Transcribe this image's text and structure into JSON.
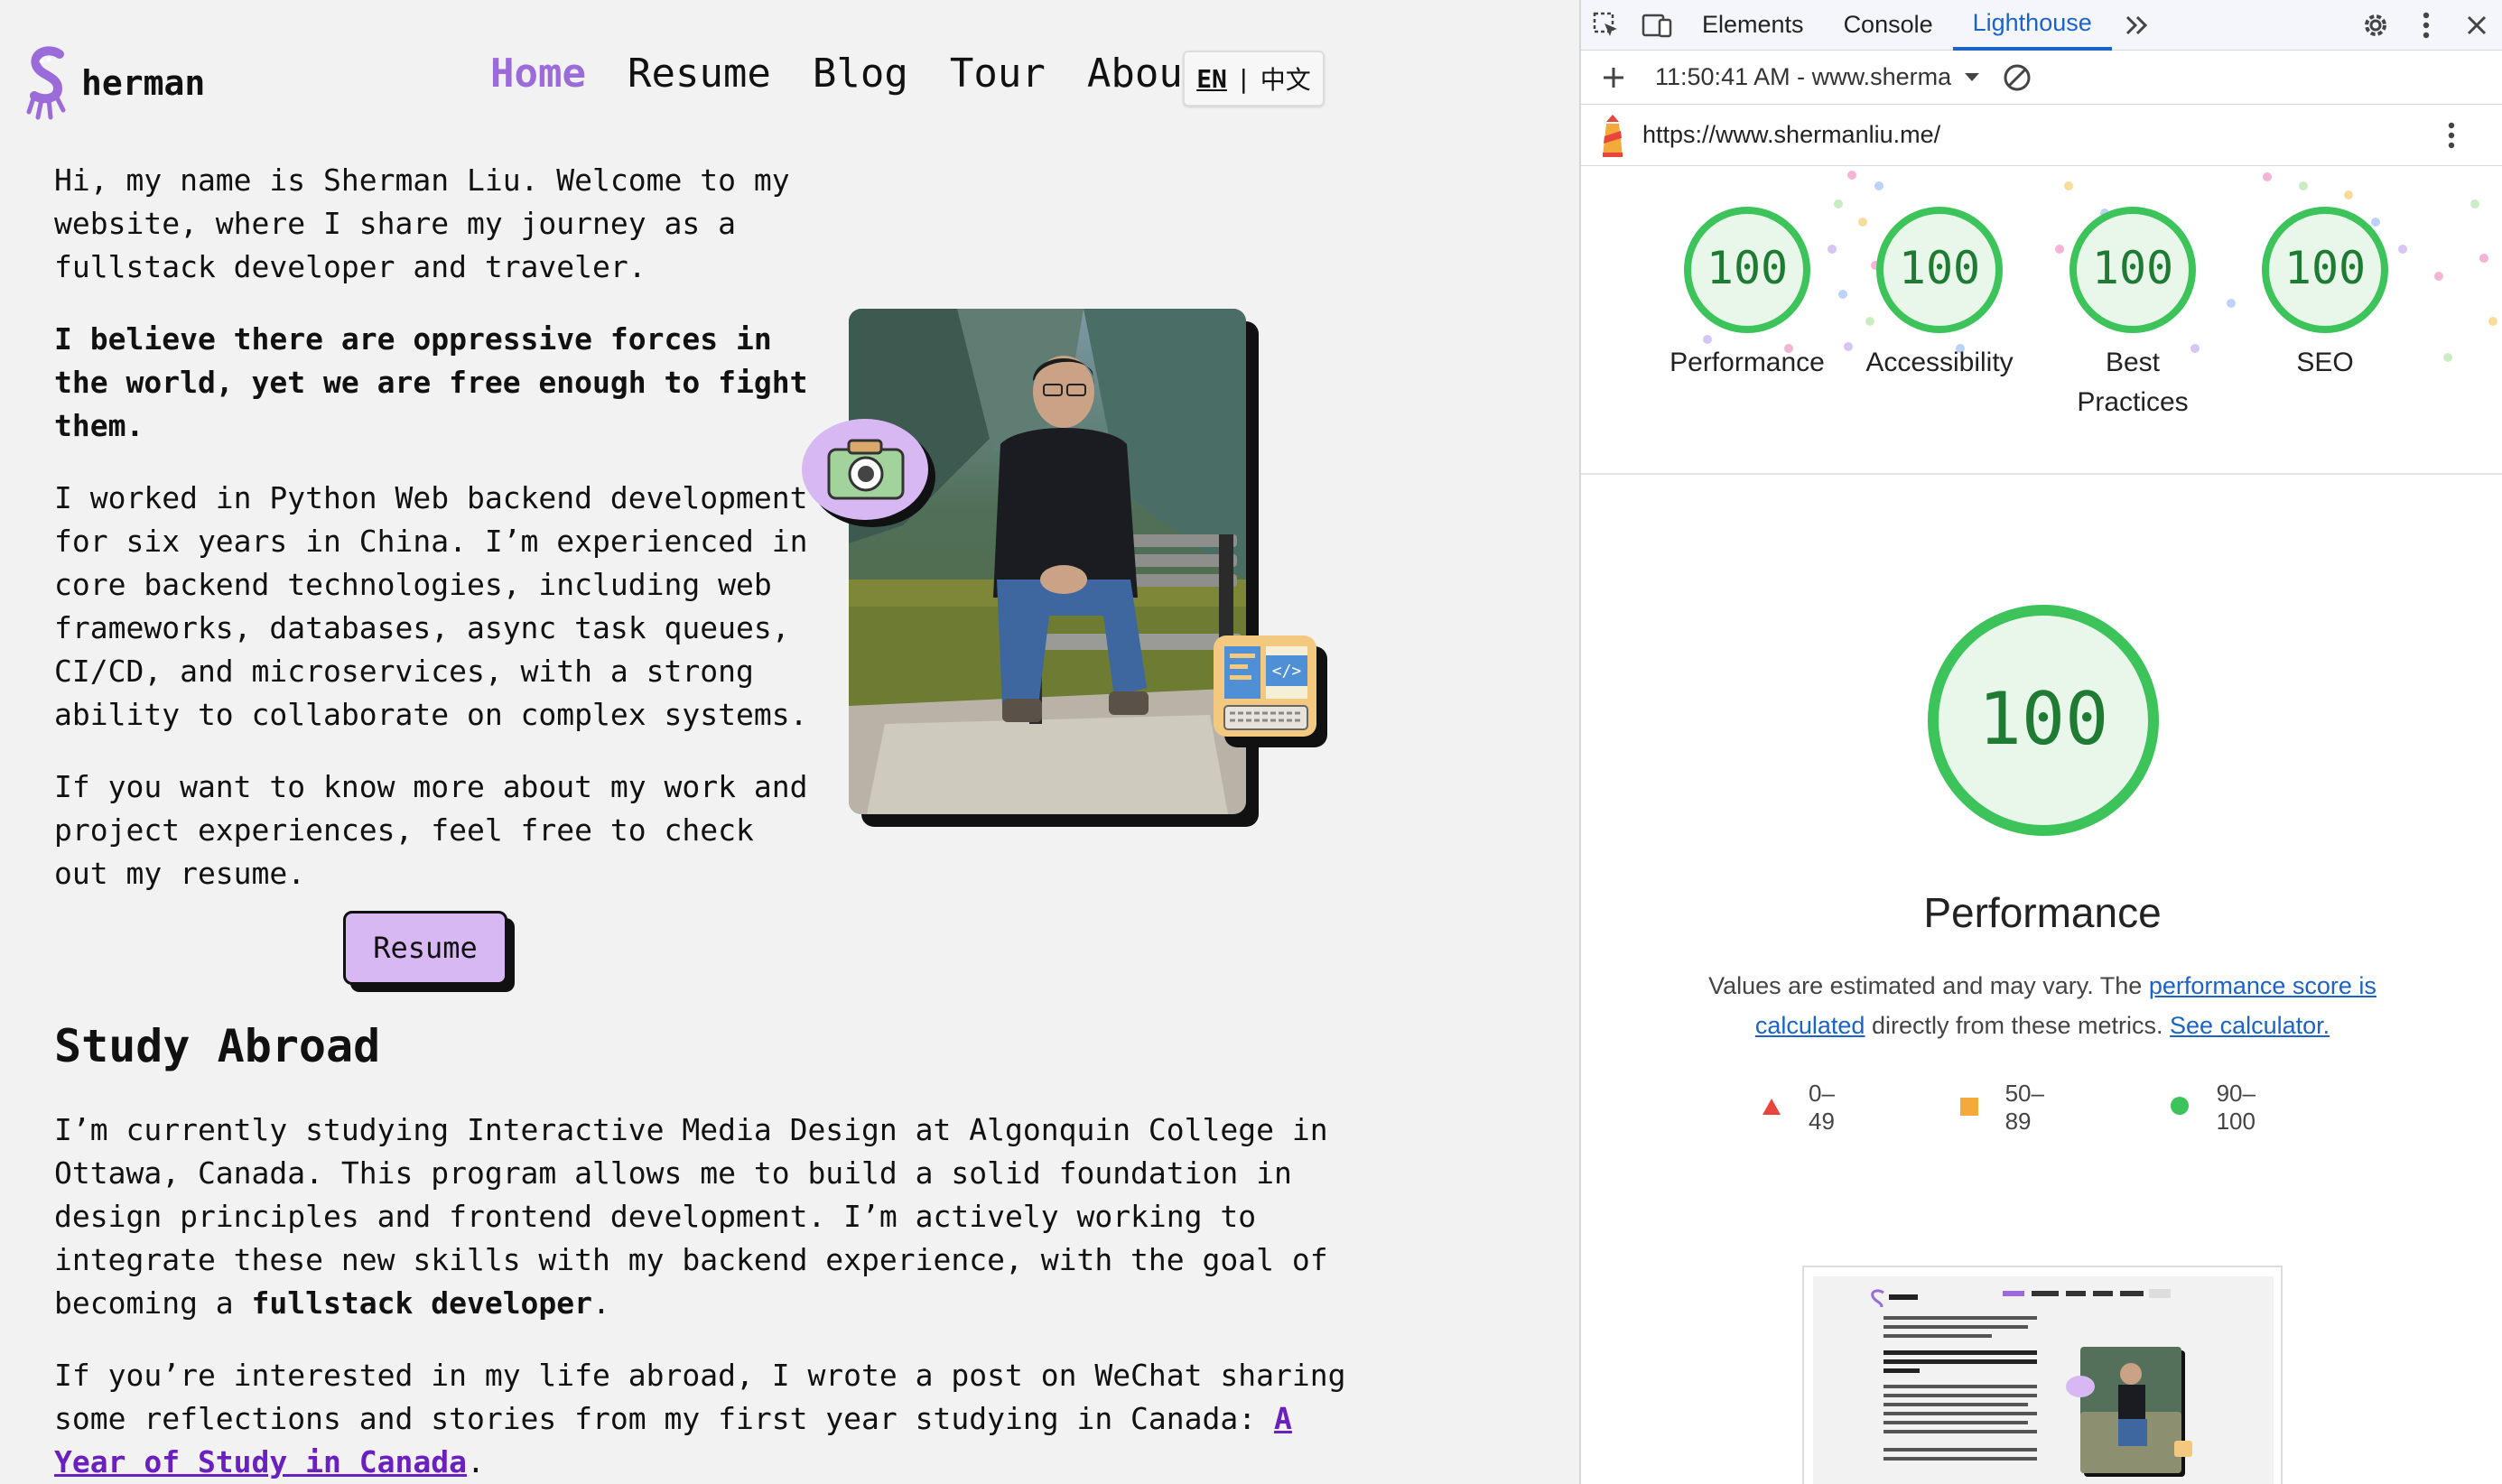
{
  "site": {
    "logo_text": "herman",
    "nav": [
      {
        "label": "Home",
        "active": true
      },
      {
        "label": "Resume",
        "active": false
      },
      {
        "label": "Blog",
        "active": false
      },
      {
        "label": "Tour",
        "active": false
      },
      {
        "label": "About",
        "active": false
      }
    ],
    "lang_en": "EN",
    "lang_sep": "|",
    "lang_zh": "中文",
    "intro": "Hi, my name is Sherman Liu. Welcome to my website, where I share my journey as a fullstack developer and traveler.",
    "belief": "I believe there are oppressive forces in the world, yet we are free enough to fight them.",
    "worked": "I worked in Python Web backend development for six years in China. I’m experienced in core backend technologies, including web frameworks, databases, async task queues, CI/CD, and microservices, with a strong ability to collaborate on complex systems.",
    "more": "If you want to know more about my work and project experiences, feel free to check out my resume.",
    "resume_button": "Resume",
    "study_heading": "Study Abroad",
    "study_pre": "I’m currently studying Interactive Media Design at Algonquin College in Ottawa, Canada. This program allows me to build a solid foundation in design principles and frontend development. I’m actively working to integrate these new skills with my backend experience, with the goal of becoming a ",
    "study_bold": "fullstack developer",
    "study_post": ".",
    "wechat_pre": "If you’re interested in my life abroad, I wrote a post on WeChat sharing some reflections and stories from my first year studying in Canada: ",
    "wechat_link": "A Year of Study in Canada",
    "wechat_post": ".",
    "accent_color": "#9a6bd9",
    "button_color": "#d7b8f3"
  },
  "devtools": {
    "tabs": [
      {
        "label": "Elements",
        "active": false
      },
      {
        "label": "Console",
        "active": false
      },
      {
        "label": "Lighthouse",
        "active": true
      }
    ],
    "report_label": "11:50:41 AM - www.sherma",
    "url": "https://www.shermanliu.me/",
    "categories": [
      {
        "label": "Performance",
        "score": 100
      },
      {
        "label": "Accessibility",
        "score": 100
      },
      {
        "label": "Best Practices",
        "score": 100
      },
      {
        "label": "SEO",
        "score": 100
      }
    ],
    "main_score": "100",
    "main_label": "Performance",
    "desc_pre": "Values are estimated and may vary. The ",
    "desc_link": "performance score is calculated",
    "desc_mid": " directly from these metrics. ",
    "desc_link2": "See calculator.",
    "legend": [
      {
        "label": "0–49",
        "shape": "triangle",
        "color": "#e8453c"
      },
      {
        "label": "50–89",
        "shape": "square",
        "color": "#f4a93b"
      },
      {
        "label": "90–100",
        "shape": "circle",
        "color": "#3cc35a"
      }
    ],
    "pass_color": "#3cc35a",
    "link_color": "#1a63c9"
  }
}
